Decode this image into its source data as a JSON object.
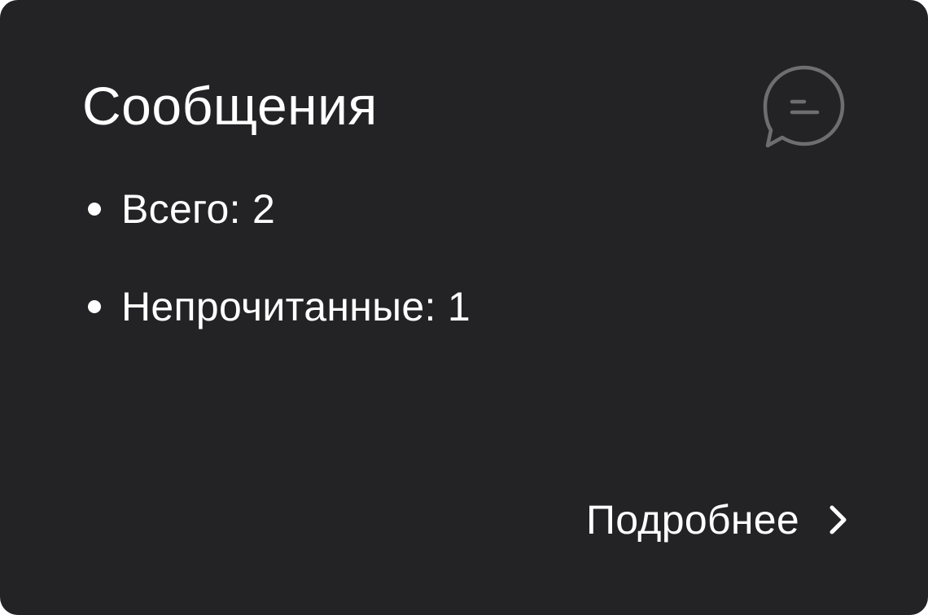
{
  "card": {
    "title": "Сообщения",
    "icon": "chat-bubble-icon",
    "stats": [
      {
        "label": "Всего: 2"
      },
      {
        "label": "Непрочитанные: 1"
      }
    ],
    "more_link": {
      "label": "Подробнее",
      "icon": "chevron-right-icon"
    }
  },
  "colors": {
    "card_background": "#232325",
    "text": "#ffffff",
    "icon": "#6e6e70"
  }
}
